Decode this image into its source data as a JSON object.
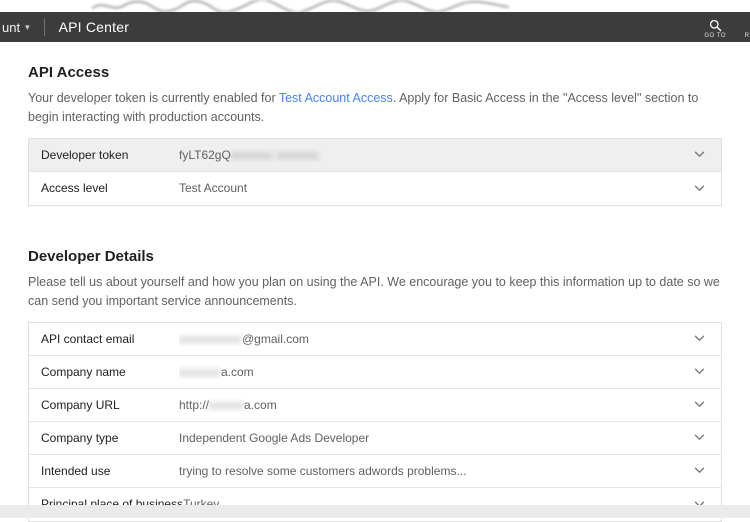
{
  "topbar": {
    "account_label": "unt",
    "title": "API Center",
    "goto_label": "GO TO",
    "right_partial_label": "R"
  },
  "icons": {
    "caret_down": "▾"
  },
  "api_access": {
    "heading": "API Access",
    "desc_prefix": "Your developer token is currently enabled for ",
    "desc_link": "Test Account Access",
    "desc_suffix": ". Apply for Basic Access in the \"Access level\" section to begin interacting with production accounts.",
    "rows": [
      {
        "label": "Developer token",
        "value_prefix": "fyLT62gQ",
        "value_redacted": "xxxxxx xxxxxx",
        "value_suffix": ""
      },
      {
        "label": "Access level",
        "value_prefix": "Test Account",
        "value_redacted": "",
        "value_suffix": ""
      }
    ]
  },
  "developer_details": {
    "heading": "Developer Details",
    "description": "Please tell us about yourself and how you plan on using the API. We encourage you to keep this information up to date so we can send you important service announcements.",
    "rows": [
      {
        "label": "API contact email",
        "value_prefix": "",
        "value_redacted": "xxxxxxxxx",
        "value_suffix": "@gmail.com"
      },
      {
        "label": "Company name",
        "value_prefix": "",
        "value_redacted": "xxxxxx",
        "value_suffix": "a.com"
      },
      {
        "label": "Company URL",
        "value_prefix": "http://",
        "value_redacted": "xxxxx",
        "value_suffix": "a.com"
      },
      {
        "label": "Company type",
        "value_prefix": "Independent Google Ads Developer",
        "value_redacted": "",
        "value_suffix": ""
      },
      {
        "label": "Intended use",
        "value_prefix": "trying to resolve some customers adwords problems...",
        "value_redacted": "",
        "value_suffix": ""
      },
      {
        "label": "Principal place of business",
        "value_prefix": "Turkey",
        "value_redacted": "",
        "value_suffix": ""
      }
    ]
  },
  "colors": {
    "header_bg": "#3c3c3c",
    "link": "#4285f4",
    "row_highlight": "#efefef",
    "border": "#e0e0e0"
  }
}
